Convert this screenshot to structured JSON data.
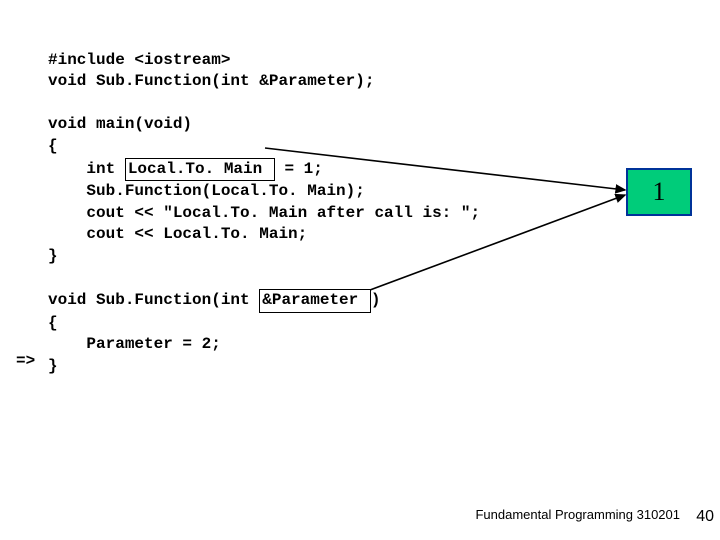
{
  "code": {
    "l1": "#include <iostream>",
    "l2": "void Sub.Function(int &Parameter);",
    "l3": "",
    "l4": "void main(void)",
    "l5": "{",
    "l6a": "    int ",
    "l6box": "Local.To. Main ",
    "l6b": "= 1;",
    "l7": "    Sub.Function(Local.To. Main);",
    "l8": "    cout << \"Local.To. Main after call is: \";",
    "l9": "    cout << Local.To. Main;",
    "l10": "}",
    "l11": "",
    "l12a": "void Sub.Function(int ",
    "l12box": "&Parameter ",
    "l12b": ")",
    "l13": "{",
    "l14": "    Parameter = 2;",
    "l15": "}"
  },
  "pointer": "=>",
  "value_box": "1",
  "footer": "Fundamental Programming 310201",
  "page": "40"
}
